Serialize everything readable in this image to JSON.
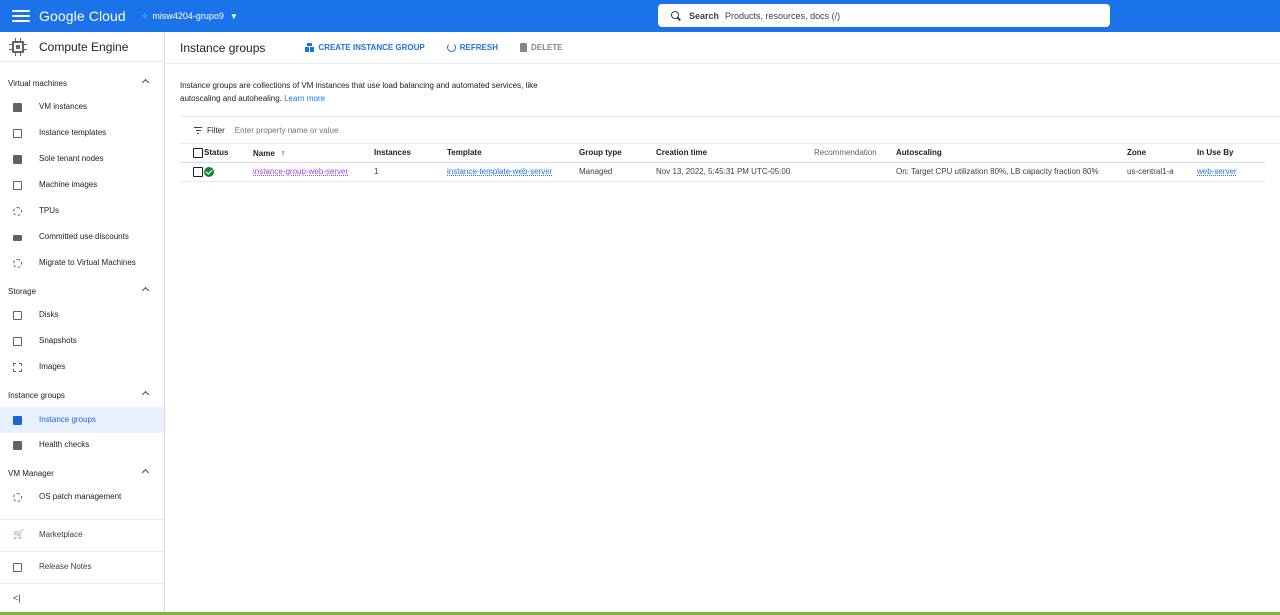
{
  "topbar": {
    "brand": "Google Cloud",
    "project": "misw4204-grupo9",
    "search_label": "Search",
    "search_placeholder": "Products, resources, docs (/)"
  },
  "sidebar": {
    "title": "Compute Engine",
    "sections": [
      {
        "label": "Virtual machines",
        "items": [
          "VM instances",
          "Instance templates",
          "Sole tenant nodes",
          "Machine images",
          "TPUs",
          "Committed use discounts",
          "Migrate to Virtual Machines"
        ]
      },
      {
        "label": "Storage",
        "items": [
          "Disks",
          "Snapshots",
          "Images"
        ]
      },
      {
        "label": "Instance groups",
        "items": [
          "Instance groups",
          "Health checks"
        ]
      },
      {
        "label": "VM Manager",
        "items": [
          "OS patch management"
        ]
      }
    ],
    "footer": [
      "Marketplace",
      "Release Notes"
    ],
    "collapse_label": "<|"
  },
  "main": {
    "title": "Instance groups",
    "actions": {
      "create": "CREATE INSTANCE GROUP",
      "refresh": "REFRESH",
      "delete": "DELETE"
    },
    "description": "Instance groups are collections of VM instances that use load balancing and automated services, like autoscaling and autohealing.",
    "learn_more": "Learn more",
    "filter_label": "Filter",
    "filter_placeholder": "Enter property name or value",
    "columns": [
      "Status",
      "Name",
      "Instances",
      "Template",
      "Group type",
      "Creation time",
      "Recommendation",
      "Autoscaling",
      "Zone",
      "In Use By"
    ],
    "rows": [
      {
        "status": "ok",
        "name": "instance-group-web-server",
        "instances": "1",
        "template": "instance-template-web-server",
        "group_type": "Managed",
        "creation_time": "Nov 13, 2022, 5:45:31 PM UTC-05:00",
        "recommendation": "",
        "autoscaling": "On: Target CPU utilization 80%, LB capacity fraction 80%",
        "zone": "us-central1-a",
        "in_use_by": "web-server"
      }
    ]
  },
  "colors": {
    "topbar": "#1a73e8",
    "link": "#1a73e8",
    "visited_link": "#a142f4",
    "status_ok": "#188038",
    "active_bg": "#e8f0fe"
  }
}
